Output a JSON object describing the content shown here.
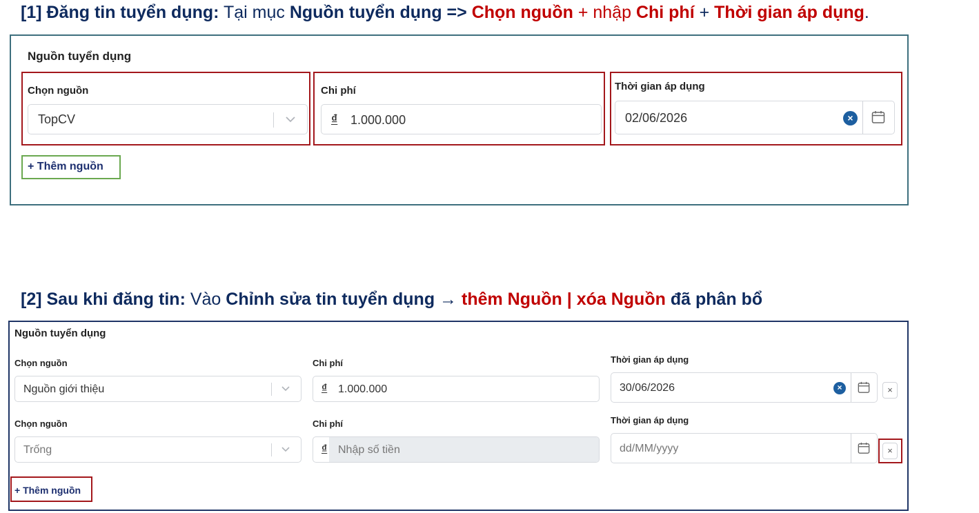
{
  "step1": {
    "heading": {
      "prefix": "[1] Đăng tin tuyển dụng:",
      "t1": " Tại mục ",
      "section": "Nguồn tuyển dụng =>",
      "choose": " Chọn nguồn",
      "plus1": " + nhập ",
      "cost": "Chi phí",
      "plus2": " + ",
      "time": "Thời gian áp dụng",
      "dot": "."
    },
    "form": {
      "section_title": "Nguồn tuyển dụng",
      "source_label": "Chọn nguồn",
      "source_value": "TopCV",
      "cost_label": "Chi phí",
      "currency_symbol": "₫",
      "cost_value": "1.000.000",
      "time_label": "Thời gian áp dụng",
      "time_value": "02/06/2026",
      "add_source": "+ Thêm nguồn"
    }
  },
  "step2": {
    "heading": {
      "prefix": "[2] Sau khi đăng tin:",
      "t1": " Vào ",
      "edit": "Chỉnh sửa tin tuyển dụng",
      "arrow": " → ",
      "add_remove": "thêm Nguồn | xóa Nguồn",
      "rest": " đã phân bổ"
    },
    "form": {
      "section_title": "Nguồn tuyển dụng",
      "rows": [
        {
          "source_label": "Chọn nguồn",
          "source_value": "Nguồn giới thiệu",
          "cost_label": "Chi phí",
          "currency_symbol": "₫",
          "cost_value": "1.000.000",
          "time_label": "Thời gian áp dụng",
          "time_value": "30/06/2026",
          "remove": "×"
        },
        {
          "source_label": "Chọn nguồn",
          "source_placeholder": "Trống",
          "cost_label": "Chi phí",
          "currency_symbol": "₫",
          "cost_placeholder": "Nhập số tiền",
          "time_label": "Thời gian áp dụng",
          "time_placeholder": "dd/MM/yyyy",
          "remove": "×"
        }
      ],
      "add_source": "+ Thêm nguồn"
    }
  },
  "colors": {
    "navy": "#0e2a5e",
    "red": "#c00000",
    "highlight_box": "#a3171b",
    "green_box": "#6aa84f",
    "frame1_border": "#3d6f7d",
    "frame2_border": "#1f3566",
    "clear_button": "#1d5fa0",
    "disabled_bg": "#e9ecef"
  },
  "icons": [
    "chevron-down-icon",
    "calendar-icon",
    "clear-icon",
    "close-icon"
  ]
}
